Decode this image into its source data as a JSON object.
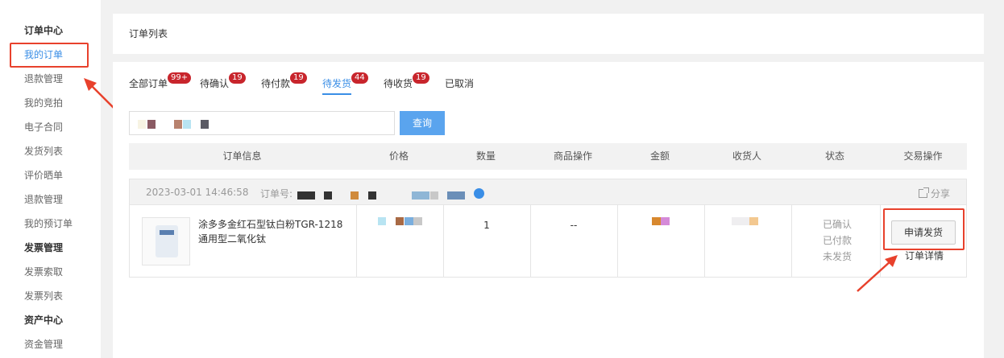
{
  "sidebar": {
    "items": [
      {
        "label": "订单中心",
        "kind": "group"
      },
      {
        "label": "我的订单",
        "kind": "active"
      },
      {
        "label": "退款管理",
        "kind": "item"
      },
      {
        "label": "我的竞拍",
        "kind": "item"
      },
      {
        "label": "电子合同",
        "kind": "item"
      },
      {
        "label": "发货列表",
        "kind": "item"
      },
      {
        "label": "评价晒单",
        "kind": "item"
      },
      {
        "label": "退款管理",
        "kind": "item"
      },
      {
        "label": "我的预订单",
        "kind": "item"
      },
      {
        "label": "发票管理",
        "kind": "group"
      },
      {
        "label": "发票索取",
        "kind": "item"
      },
      {
        "label": "发票列表",
        "kind": "item"
      },
      {
        "label": "资产中心",
        "kind": "group"
      },
      {
        "label": "资金管理",
        "kind": "item"
      }
    ]
  },
  "header": {
    "title": "订单列表"
  },
  "tabs": [
    {
      "label": "全部订单",
      "badge": "99+"
    },
    {
      "label": "待确认",
      "badge": "19"
    },
    {
      "label": "待付款",
      "badge": "19"
    },
    {
      "label": "待发货",
      "badge": "44",
      "active": true
    },
    {
      "label": "待收货",
      "badge": "19"
    },
    {
      "label": "已取消",
      "badge": ""
    }
  ],
  "search": {
    "button_label": "查询"
  },
  "table": {
    "columns": [
      "订单信息",
      "价格",
      "数量",
      "商品操作",
      "金额",
      "收货人",
      "状态",
      "交易操作"
    ]
  },
  "order": {
    "time": "2023-03-01 14:46:58",
    "order_no_label": "订单号:",
    "share_label": "分享",
    "product_name": "涂多多金红石型钛白粉TGR-1218通用型二氧化钛",
    "quantity": "1",
    "product_op": "--",
    "status": [
      "已确认",
      "已付款",
      "未发货"
    ],
    "apply_label": "申请发货",
    "detail_label": "订单详情"
  },
  "colors": {
    "accent": "#3a8ee6",
    "badge": "#c8252c",
    "annotation": "#e8412c",
    "search_button": "#5aa4ee"
  }
}
